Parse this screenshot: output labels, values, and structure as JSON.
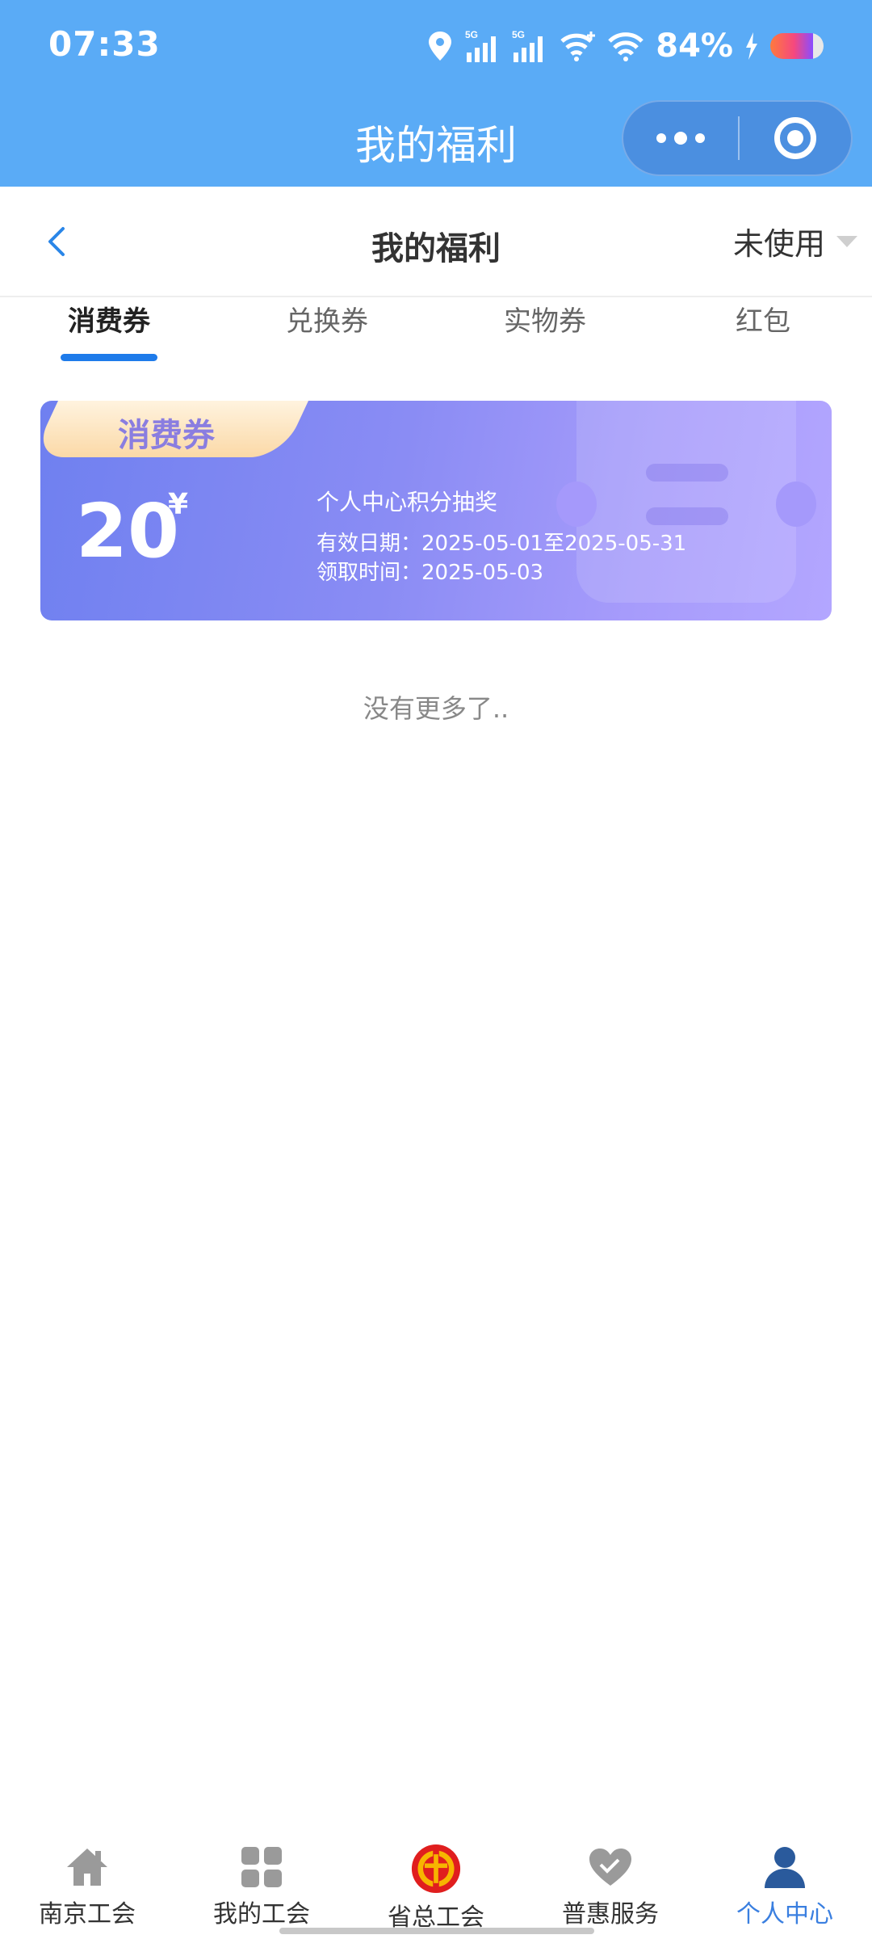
{
  "status_bar": {
    "time": "07:33",
    "battery": "84%",
    "icons": [
      "location-icon",
      "signal-5g-icon",
      "signal-5g-icon",
      "wifi-plus-icon",
      "wifi-icon",
      "charging-icon"
    ]
  },
  "mini_program_bar": {
    "title": "我的福利"
  },
  "header": {
    "title": "我的福利",
    "filter_label": "未使用"
  },
  "tabs": [
    {
      "label": "消费券",
      "active": true
    },
    {
      "label": "兑换券",
      "active": false
    },
    {
      "label": "实物券",
      "active": false
    },
    {
      "label": "红包",
      "active": false
    }
  ],
  "coupon": {
    "type_label": "消费券",
    "amount": "20",
    "currency": "¥",
    "name": "个人中心积分抽奖",
    "valid_period": "有效日期：2025-05-01至2025-05-31",
    "received_time": "领取时间：2025-05-03"
  },
  "no_more_text": "没有更多了..",
  "bottom_nav": [
    {
      "label": "南京工会",
      "icon": "home-icon",
      "active": false
    },
    {
      "label": "我的工会",
      "icon": "grid-icon",
      "active": false
    },
    {
      "label": "省总工会",
      "icon": "union-logo-icon",
      "active": false
    },
    {
      "label": "普惠服务",
      "icon": "heart-icon",
      "active": false
    },
    {
      "label": "个人中心",
      "icon": "user-icon",
      "active": true
    }
  ],
  "colors": {
    "top_bar": "#5aabf6",
    "accent": "#1e7bea",
    "active_nav": "#3a7fe0",
    "coupon_start": "#6f80f0",
    "coupon_end": "#b3a6ff"
  }
}
